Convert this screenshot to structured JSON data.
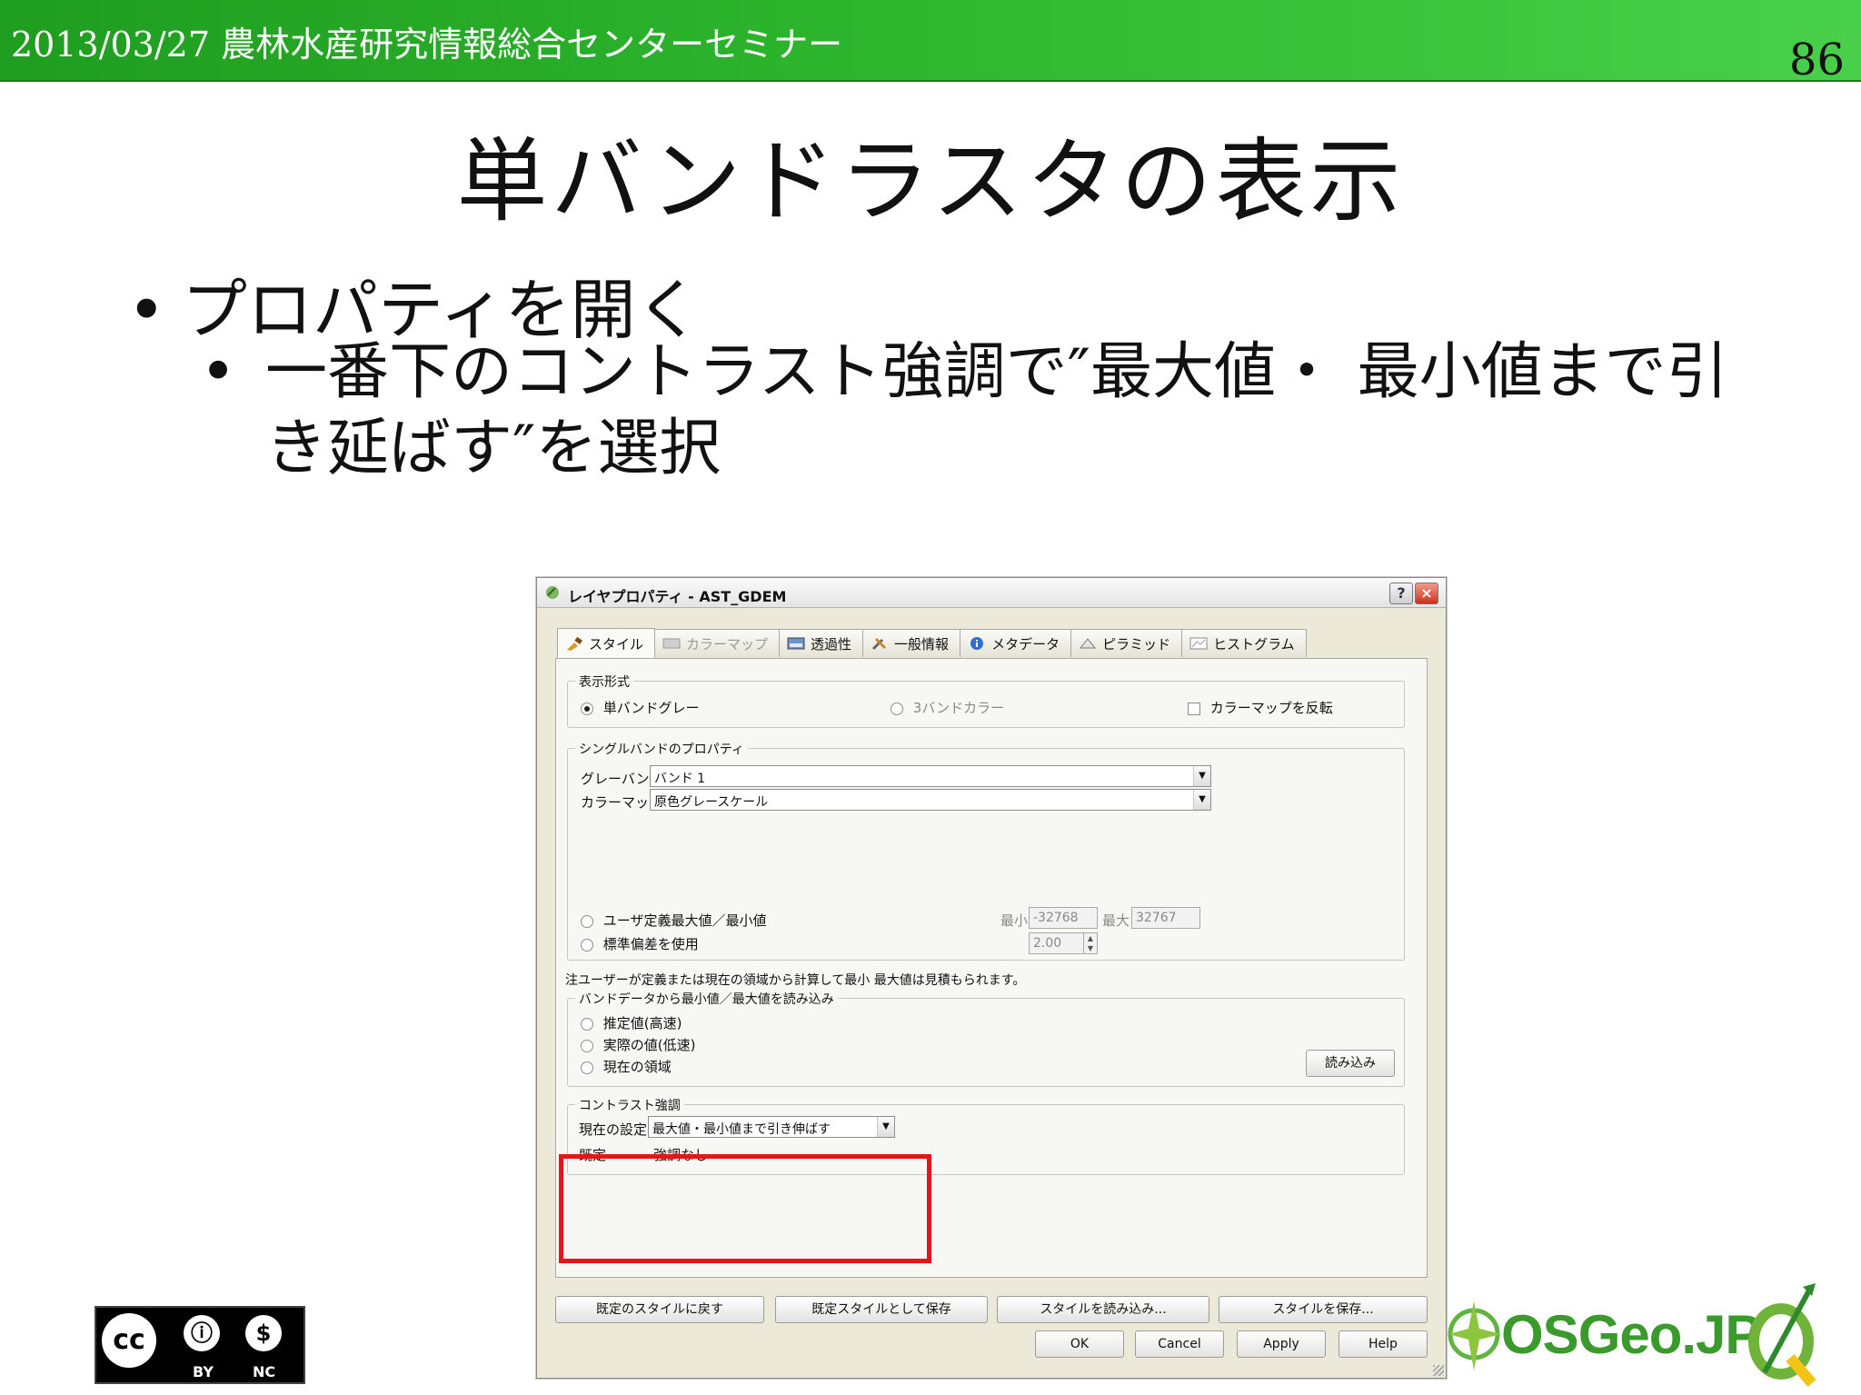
{
  "header": {
    "text": "2013/03/27 農林水産研究情報総合センターセミナー",
    "page_number": "86"
  },
  "slide": {
    "title": "単バンドラスタの表示",
    "bullet1": "プロパティを開く",
    "bullet2": "一番下のコントラスト強調で″最大値・ 最小値まで引き延ばす″を選択",
    "bullet_glyph": "•"
  },
  "dialog": {
    "title": "レイヤプロパティ - AST_GDEM",
    "help_button": "?",
    "close_button": "×",
    "tabs": [
      {
        "label": "スタイル",
        "icon": "brush-icon",
        "state": "active"
      },
      {
        "label": "カラーマップ",
        "icon": "colormap-icon",
        "state": "disabled"
      },
      {
        "label": "透過性",
        "icon": "transparency-icon",
        "state": "normal"
      },
      {
        "label": "一般情報",
        "icon": "tools-icon",
        "state": "normal"
      },
      {
        "label": "メタデータ",
        "icon": "info-icon",
        "state": "normal"
      },
      {
        "label": "ピラミッド",
        "icon": "pyramid-icon",
        "state": "normal"
      },
      {
        "label": "ヒストグラム",
        "icon": "histogram-icon",
        "state": "normal"
      }
    ],
    "display_mode": {
      "group_label": "表示形式",
      "single_band_gray": "単バンドグレー",
      "three_band_color": "3バンドカラー",
      "invert_colormap": "カラーマップを反転",
      "selected": "単バンドグレー"
    },
    "single_band": {
      "group_label": "シングルバンドのプロパティ",
      "gray_band_label": "グレーバンド",
      "gray_band_value": "バンド 1",
      "color_map_label": "カラーマップ",
      "color_map_value": "原色グレースケール",
      "user_minmax": "ユーザ定義最大値／最小値",
      "std_dev": "標準偏差を使用",
      "min_label": "最小",
      "min_value": "-32768",
      "max_label": "最大",
      "max_value": "32767",
      "std_value": "2.00"
    },
    "note": "注ユーザーが定義または現在の領域から計算して最小 最大値は見積もられます。",
    "load_minmax": {
      "group_label": "バンドデータから最小値／最大値を読み込み",
      "estimate": "推定値(高速)",
      "actual": "実際の値(低速)",
      "current_extent": "現在の領域",
      "load_button": "読み込み"
    },
    "contrast": {
      "group_label": "コントラスト強調",
      "current_label": "現在の設定",
      "current_value": "最大値・最小値まで引き伸ばす",
      "default_label": "既定",
      "default_value": "強調なし"
    },
    "bottom_buttons": {
      "restore_default": "既定のスタイルに戻す",
      "save_as_default": "既定スタイルとして保存",
      "load_style": "スタイルを読み込み...",
      "save_style": "スタイルを保存...",
      "ok": "OK",
      "cancel": "Cancel",
      "apply": "Apply",
      "help": "Help"
    }
  },
  "footer": {
    "cc_symbol": "cc",
    "cc_by": "BY",
    "cc_nc": "NC",
    "by_glyph": "ⓘ",
    "nc_glyph": "$",
    "osgeo_logo": "OSGeo.JP"
  },
  "colors": {
    "header_green": "#2db52d",
    "highlight_red": "#e8141a",
    "osgeo_green": "#3a9a2c"
  }
}
